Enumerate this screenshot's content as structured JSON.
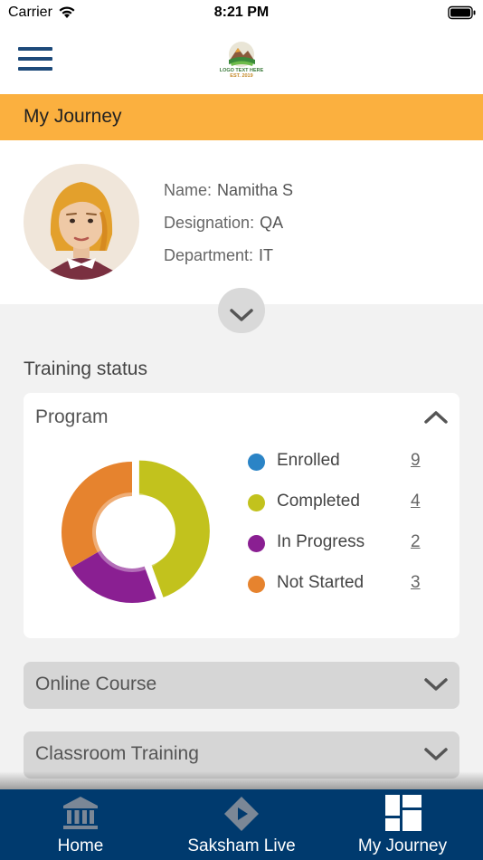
{
  "status_bar": {
    "carrier": "Carrier",
    "time": "8:21 PM"
  },
  "header": {
    "menu_icon": "hamburger-menu-icon",
    "logo_text": "LOGO TEXT HERE",
    "logo_sub": "EST. 2019"
  },
  "page": {
    "title": "My Journey"
  },
  "profile": {
    "name_label": "Name:",
    "name": "Namitha S",
    "designation_label": "Designation:",
    "designation": "QA",
    "department_label": "Department:",
    "department": "IT",
    "expand_icon": "chevron-down-icon"
  },
  "training": {
    "section_title": "Training status",
    "program": {
      "title": "Program",
      "collapse_icon": "chevron-up-icon",
      "legend": [
        {
          "label": "Enrolled",
          "count": "9",
          "color": "#2b84c6"
        },
        {
          "label": "Completed",
          "count": "4",
          "color": "#c2c21d"
        },
        {
          "label": "In Progress",
          "count": "2",
          "color": "#8a1f92"
        },
        {
          "label": "Not Started",
          "count": "3",
          "color": "#e6832e"
        }
      ]
    },
    "online_course": {
      "title": "Online Course"
    },
    "classroom": {
      "title": "Classroom Training"
    }
  },
  "chart_data": {
    "type": "pie",
    "categories": [
      "Completed",
      "In Progress",
      "Not Started"
    ],
    "values": [
      4,
      2,
      3
    ],
    "colors": [
      "#c2c21d",
      "#8a1f92",
      "#e6832e"
    ],
    "hole": true
  },
  "tabs": [
    {
      "label": "Home",
      "icon": "home-bank-icon",
      "color": "#ffffff"
    },
    {
      "label": "Saksham Live",
      "icon": "live-diamond-icon",
      "color": "#ffffff"
    },
    {
      "label": "My Journey",
      "icon": "dashboard-grid-icon",
      "color": "#ffffff"
    }
  ],
  "colors": {
    "accent": "#fbb03f",
    "nav": "#003a6e",
    "menu": "#1d4a7a"
  }
}
